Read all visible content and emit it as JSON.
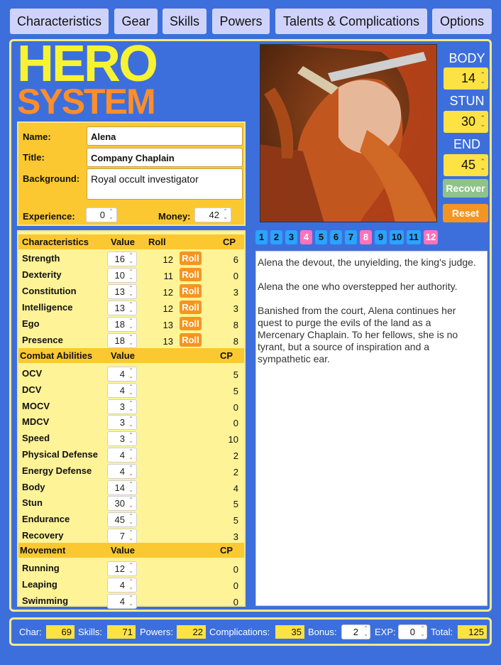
{
  "tabs": [
    "Characteristics",
    "Gear",
    "Skills",
    "Powers",
    "Talents & Complications",
    "Options"
  ],
  "logo": {
    "line1": "HERO",
    "line2": "SYSTEM"
  },
  "identity": {
    "name_label": "Name:",
    "name": "Alena",
    "title_label": "Title:",
    "title": "Company Chaplain",
    "background_label": "Background:",
    "background": "Royal occult investigator",
    "experience_label": "Experience:",
    "experience": "0",
    "money_label": "Money:",
    "money": "42"
  },
  "characteristics": {
    "header": {
      "name": "Characteristics",
      "value": "Value",
      "roll": "Roll",
      "cp": "CP"
    },
    "roll_label": "Roll",
    "rows": [
      {
        "name": "Strength",
        "value": "16",
        "roll": "12",
        "cp": "6"
      },
      {
        "name": "Dexterity",
        "value": "10",
        "roll": "11",
        "cp": "0"
      },
      {
        "name": "Constitution",
        "value": "13",
        "roll": "12",
        "cp": "3"
      },
      {
        "name": "Intelligence",
        "value": "13",
        "roll": "12",
        "cp": "3"
      },
      {
        "name": "Ego",
        "value": "18",
        "roll": "13",
        "cp": "8"
      },
      {
        "name": "Presence",
        "value": "18",
        "roll": "13",
        "cp": "8"
      }
    ]
  },
  "combat": {
    "header": {
      "name": "Combat Abilities",
      "value": "Value",
      "cp": "CP"
    },
    "rows": [
      {
        "name": "OCV",
        "value": "4",
        "cp": "5"
      },
      {
        "name": "DCV",
        "value": "4",
        "cp": "5"
      },
      {
        "name": "MOCV",
        "value": "3",
        "cp": "0"
      },
      {
        "name": "MDCV",
        "value": "3",
        "cp": "0"
      },
      {
        "name": "Speed",
        "value": "3",
        "cp": "10"
      },
      {
        "name": "Physical Defense",
        "value": "4",
        "cp": "2"
      },
      {
        "name": "Energy Defense",
        "value": "4",
        "cp": "2"
      },
      {
        "name": "Body",
        "value": "14",
        "cp": "4"
      },
      {
        "name": "Stun",
        "value": "30",
        "cp": "5"
      },
      {
        "name": "Endurance",
        "value": "45",
        "cp": "5"
      },
      {
        "name": "Recovery",
        "value": "7",
        "cp": "3"
      }
    ]
  },
  "movement": {
    "header": {
      "name": "Movement",
      "value": "Value",
      "cp": "CP"
    },
    "rows": [
      {
        "name": "Running",
        "value": "12",
        "cp": "0"
      },
      {
        "name": "Leaping",
        "value": "4",
        "cp": "0"
      },
      {
        "name": "Swimming",
        "value": "4",
        "cp": "0"
      }
    ]
  },
  "vitals": {
    "body_label": "BODY",
    "body": "14",
    "stun_label": "STUN",
    "stun": "30",
    "end_label": "END",
    "end": "45",
    "recover_label": "Recover",
    "reset_label": "Reset"
  },
  "segments": {
    "labels": [
      "1",
      "2",
      "3",
      "4",
      "5",
      "6",
      "7",
      "8",
      "9",
      "10",
      "11",
      "12"
    ],
    "active_color": "#ff74b8",
    "inactive_color": "#2ba3ff",
    "active": [
      "4",
      "8",
      "12"
    ]
  },
  "notes": {
    "p1": "Alena the devout, the unyielding, the king's judge.",
    "p2": "Alena the one who overstepped her authority.",
    "p3": "Banished from the court, Alena continues her quest to purge the evils of the land as a Mercenary Chaplain. To her fellows, she is no tyrant, but a source of inspiration and a sympathetic ear."
  },
  "footer": {
    "char_label": "Char:",
    "char": "69",
    "skills_label": "Skills:",
    "skills": "71",
    "powers_label": "Powers:",
    "powers": "22",
    "complications_label": "Complications:",
    "complications": "35",
    "bonus_label": "Bonus:",
    "bonus": "2",
    "exp_label": "EXP:",
    "exp": "0",
    "total_label": "Total:",
    "total": "125"
  },
  "colors": {
    "background": "#3d6fdc",
    "header": "#fbc832",
    "table": "#fef397",
    "accent": "#f59521",
    "recover": "#8fc38a"
  }
}
